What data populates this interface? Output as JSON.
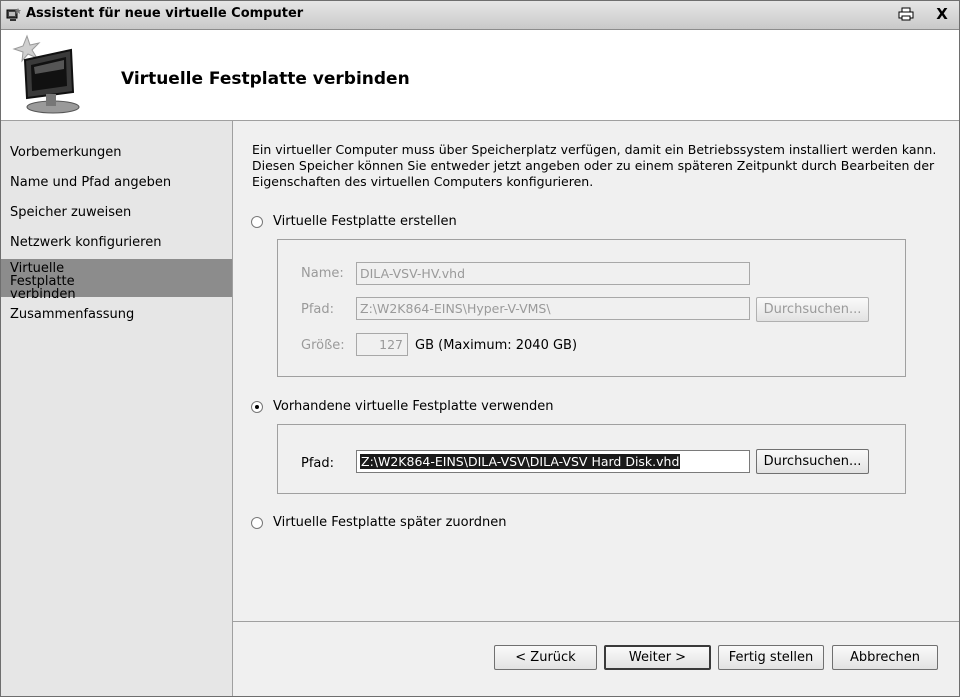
{
  "titlebar": {
    "title": "Assistent für neue virtuelle Computer",
    "icons": [
      "wizard-icon",
      "printer-icon",
      "close-icon"
    ],
    "close_glyph": "X"
  },
  "header": {
    "title": "Virtuelle Festplatte verbinden",
    "icon": "virtual-computer-icon"
  },
  "sidebar": {
    "items": [
      {
        "label": "Vorbemerkungen"
      },
      {
        "label": "Name und Pfad angeben"
      },
      {
        "label": "Speicher zuweisen"
      },
      {
        "label": "Netzwerk konfigurieren"
      },
      {
        "label": "Virtuelle Festplatte verbinden",
        "active": true
      },
      {
        "label": "Zusammenfassung"
      }
    ]
  },
  "content": {
    "description": "Ein virtueller Computer muss über Speicherplatz verfügen, damit ein Betriebssystem installiert werden kann. Diesen Speicher können Sie entweder jetzt angeben oder zu einem späteren Zeitpunkt durch Bearbeiten der Eigenschaften des virtuellen Computers konfigurieren.",
    "option_create": {
      "label": "Virtuelle Festplatte erstellen",
      "selected": false,
      "name_label": "Name:",
      "name_value": "DILA-VSV-HV.vhd",
      "path_label": "Pfad:",
      "path_value": "Z:\\W2K864-EINS\\Hyper-V-VMS\\",
      "browse_label": "Durchsuchen...",
      "size_label": "Größe:",
      "size_value": "127",
      "size_unit": "GB (Maximum: 2040 GB)"
    },
    "option_existing": {
      "label": "Vorhandene virtuelle Festplatte verwenden",
      "selected": true,
      "path_label": "Pfad:",
      "path_value": "Z:\\W2K864-EINS\\DILA-VSV\\DILA-VSV Hard Disk.vhd",
      "browse_label": "Durchsuchen..."
    },
    "option_later": {
      "label": "Virtuelle Festplatte später zuordnen",
      "selected": false
    }
  },
  "footer": {
    "back_label": "< Zurück",
    "next_label": "Weiter >",
    "finish_label": "Fertig stellen",
    "cancel_label": "Abbrechen"
  }
}
